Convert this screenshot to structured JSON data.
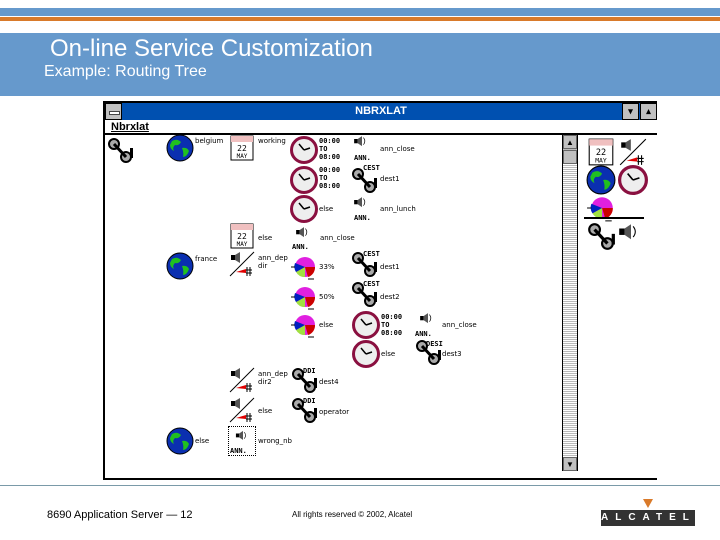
{
  "slide": {
    "title": "On-line Service Customization",
    "subtitle": "Example: Routing Tree"
  },
  "window": {
    "title": "NBRXLAT",
    "menu": "Nbrxlat",
    "minimize": "▾",
    "maximize": "▴",
    "scroll_up": "▲",
    "scroll_down": "▼"
  },
  "tree": {
    "belgium": "belgium",
    "working": "working",
    "t1": "00:00\nTO\n08:00",
    "ann_close": "ann_close",
    "ann": "ANN.",
    "t2": "00:00\nTO\n08:00",
    "cest": "CEST",
    "dest1": "dest1",
    "else": "else",
    "ann_lunch": "ann_lunch",
    "ann_close2": "ann_close",
    "france": "france",
    "ann_dep": "ann_dep",
    "dir": "dir",
    "pct33": "33%",
    "pct50": "50%",
    "dest2": "dest2",
    "t3": "00:00\nTO\n08:00",
    "desi": "DESI",
    "dest3": "dest3",
    "dir2": "dir2",
    "ddi": "DDI",
    "dest4": "dest4",
    "operator": "operator",
    "wrong_nb": "wrong_nb"
  },
  "footer": {
    "left": "8690 Application Server — 12",
    "center": "All rights reserved © 2002, Alcatel",
    "logo": "ALCATEL"
  },
  "colors": {
    "header": "#6699cc",
    "accent": "#d97a2a",
    "titlebar": "#0050b0"
  }
}
